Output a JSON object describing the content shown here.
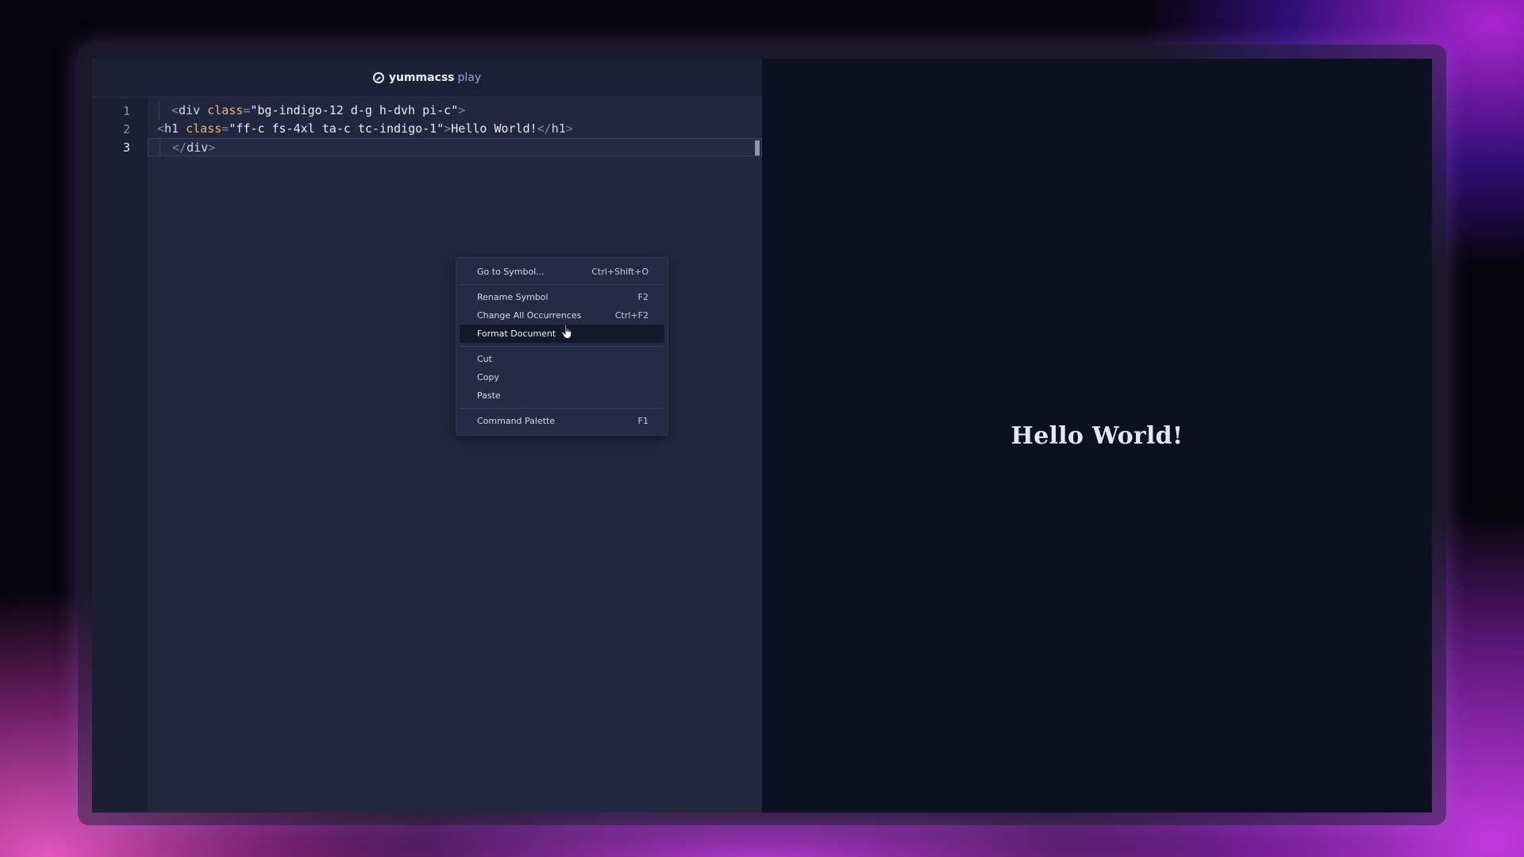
{
  "brand": {
    "name": "yummacss",
    "suffix": "play"
  },
  "editor": {
    "line_numbers": [
      "1",
      "2",
      "3"
    ],
    "lines": [
      {
        "indent": "  ",
        "parts": [
          {
            "t": "punc",
            "v": "<"
          },
          {
            "t": "tag",
            "v": "div"
          },
          {
            "t": "attr",
            "v": " class"
          },
          {
            "t": "punc",
            "v": "="
          },
          {
            "t": "str",
            "v": "\"bg-indigo-12 d-g h-dvh pi-c\""
          },
          {
            "t": "punc",
            "v": ">"
          }
        ]
      },
      {
        "indent": "",
        "parts": [
          {
            "t": "punc",
            "v": "<"
          },
          {
            "t": "tag",
            "v": "h1"
          },
          {
            "t": "attr",
            "v": " class"
          },
          {
            "t": "punc",
            "v": "="
          },
          {
            "t": "str",
            "v": "\"ff-c fs-4xl ta-c tc-indigo-1\""
          },
          {
            "t": "punc",
            "v": ">"
          },
          {
            "t": "text",
            "v": "Hello World!"
          },
          {
            "t": "punc",
            "v": "</"
          },
          {
            "t": "tag",
            "v": "h1"
          },
          {
            "t": "punc",
            "v": ">"
          }
        ]
      },
      {
        "indent": "  ",
        "parts": [
          {
            "t": "punc",
            "v": "</"
          },
          {
            "t": "tag",
            "v": "div"
          },
          {
            "t": "punc",
            "v": ">"
          }
        ]
      }
    ]
  },
  "context_menu": {
    "groups": [
      [
        {
          "label": "Go to Symbol...",
          "shortcut": "Ctrl+Shift+O"
        }
      ],
      [
        {
          "label": "Rename Symbol",
          "shortcut": "F2"
        },
        {
          "label": "Change All Occurrences",
          "shortcut": "Ctrl+F2"
        },
        {
          "label": "Format Document",
          "shortcut": "",
          "highlighted": true
        }
      ],
      [
        {
          "label": "Cut",
          "shortcut": ""
        },
        {
          "label": "Copy",
          "shortcut": ""
        },
        {
          "label": "Paste",
          "shortcut": ""
        }
      ],
      [
        {
          "label": "Command Palette",
          "shortcut": "F1"
        }
      ]
    ]
  },
  "preview": {
    "heading": "Hello World!"
  },
  "colors": {
    "editor_bg": "#23263f",
    "preview_bg": "#0d1021",
    "accent": "#a49be8"
  }
}
